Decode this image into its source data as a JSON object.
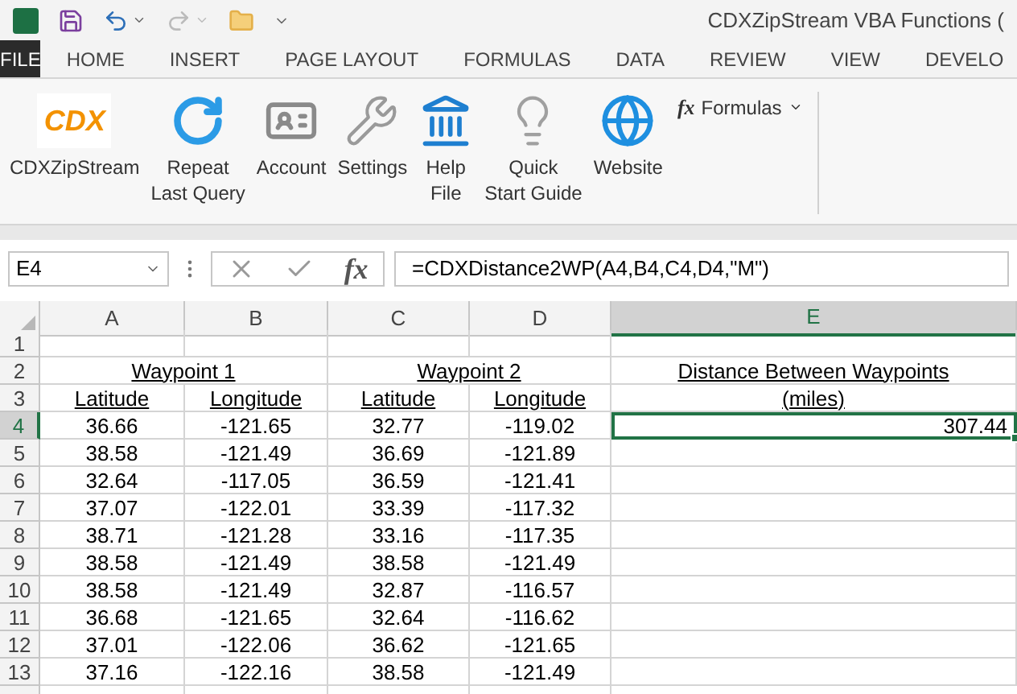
{
  "window": {
    "title": "CDXZipStream VBA Functions ("
  },
  "ribbon_tabs": [
    {
      "label": "FILE",
      "selected": true
    },
    {
      "label": "HOME",
      "selected": false
    },
    {
      "label": "INSERT",
      "selected": false
    },
    {
      "label": "PAGE LAYOUT",
      "selected": false
    },
    {
      "label": "FORMULAS",
      "selected": false
    },
    {
      "label": "DATA",
      "selected": false
    },
    {
      "label": "REVIEW",
      "selected": false
    },
    {
      "label": "VIEW",
      "selected": false
    },
    {
      "label": "DEVELO",
      "selected": false
    }
  ],
  "ribbon": {
    "logo_text": "CDX",
    "buttons": [
      {
        "lines": [
          "CDXZipStream"
        ]
      },
      {
        "lines": [
          "Repeat",
          "Last Query"
        ]
      },
      {
        "lines": [
          "Account"
        ]
      },
      {
        "lines": [
          "Settings"
        ]
      },
      {
        "lines": [
          "Help",
          "File"
        ]
      },
      {
        "lines": [
          "Quick",
          "Start Guide"
        ]
      },
      {
        "lines": [
          "Website"
        ]
      }
    ],
    "formulas_menu": {
      "icon_text": "fx",
      "label": "Formulas"
    }
  },
  "formula_bar": {
    "name_box": "E4",
    "function_button": "fx",
    "formula": "=CDXDistance2WP(A4,B4,C4,D4,\"M\")"
  },
  "sheet": {
    "columns": [
      {
        "label": "A",
        "selected": false
      },
      {
        "label": "B",
        "selected": false
      },
      {
        "label": "C",
        "selected": false
      },
      {
        "label": "D",
        "selected": false
      },
      {
        "label": "E",
        "selected": true
      }
    ],
    "rows": [
      {
        "label": "1",
        "selected": false
      },
      {
        "label": "2",
        "selected": false,
        "cells": [
          {
            "text": "Waypoint 1",
            "kind": "title",
            "selected": false
          },
          {
            "text": "Waypoint 2",
            "kind": "title",
            "selected": false
          },
          {
            "text": "Distance Between Waypoints",
            "kind": "label",
            "selected": false
          }
        ]
      },
      {
        "label": "3",
        "selected": false,
        "cells": [
          {
            "text": "Latitude",
            "kind": "label",
            "selected": false
          },
          {
            "text": "Longitude",
            "kind": "label",
            "selected": false
          },
          {
            "text": "Latitude",
            "kind": "label",
            "selected": false
          },
          {
            "text": "Longitude",
            "kind": "label",
            "selected": false
          },
          {
            "text": "(miles)",
            "kind": "label",
            "selected": false
          }
        ]
      },
      {
        "label": "4",
        "selected": true,
        "cells": [
          {
            "text": "36.66",
            "kind": "number",
            "selected": false
          },
          {
            "text": "-121.65",
            "kind": "number",
            "selected": false
          },
          {
            "text": "32.77",
            "kind": "number",
            "selected": false
          },
          {
            "text": "-119.02",
            "kind": "number",
            "selected": false
          },
          {
            "text": "307.44",
            "kind": "result",
            "selected": true
          }
        ]
      },
      {
        "label": "5",
        "selected": false,
        "cells": [
          {
            "text": "38.58",
            "kind": "number",
            "selected": false
          },
          {
            "text": "-121.49",
            "kind": "number",
            "selected": false
          },
          {
            "text": "36.69",
            "kind": "number",
            "selected": false
          },
          {
            "text": "-121.89",
            "kind": "number",
            "selected": false
          }
        ]
      },
      {
        "label": "6",
        "selected": false,
        "cells": [
          {
            "text": "32.64",
            "kind": "number",
            "selected": false
          },
          {
            "text": "-117.05",
            "kind": "number",
            "selected": false
          },
          {
            "text": "36.59",
            "kind": "number",
            "selected": false
          },
          {
            "text": "-121.41",
            "kind": "number",
            "selected": false
          }
        ]
      },
      {
        "label": "7",
        "selected": false,
        "cells": [
          {
            "text": "37.07",
            "kind": "number",
            "selected": false
          },
          {
            "text": "-122.01",
            "kind": "number",
            "selected": false
          },
          {
            "text": "33.39",
            "kind": "number",
            "selected": false
          },
          {
            "text": "-117.32",
            "kind": "number",
            "selected": false
          }
        ]
      },
      {
        "label": "8",
        "selected": false,
        "cells": [
          {
            "text": "38.71",
            "kind": "number",
            "selected": false
          },
          {
            "text": "-121.28",
            "kind": "number",
            "selected": false
          },
          {
            "text": "33.16",
            "kind": "number",
            "selected": false
          },
          {
            "text": "-117.35",
            "kind": "number",
            "selected": false
          }
        ]
      },
      {
        "label": "9",
        "selected": false,
        "cells": [
          {
            "text": "38.58",
            "kind": "number",
            "selected": false
          },
          {
            "text": "-121.49",
            "kind": "number",
            "selected": false
          },
          {
            "text": "38.58",
            "kind": "number",
            "selected": false
          },
          {
            "text": "-121.49",
            "kind": "number",
            "selected": false
          }
        ]
      },
      {
        "label": "10",
        "selected": false,
        "cells": [
          {
            "text": "38.58",
            "kind": "number",
            "selected": false
          },
          {
            "text": "-121.49",
            "kind": "number",
            "selected": false
          },
          {
            "text": "32.87",
            "kind": "number",
            "selected": false
          },
          {
            "text": "-116.57",
            "kind": "number",
            "selected": false
          }
        ]
      },
      {
        "label": "11",
        "selected": false,
        "cells": [
          {
            "text": "36.68",
            "kind": "number",
            "selected": false
          },
          {
            "text": "-121.65",
            "kind": "number",
            "selected": false
          },
          {
            "text": "32.64",
            "kind": "number",
            "selected": false
          },
          {
            "text": "-116.62",
            "kind": "number",
            "selected": false
          }
        ]
      },
      {
        "label": "12",
        "selected": false,
        "cells": [
          {
            "text": "37.01",
            "kind": "number",
            "selected": false
          },
          {
            "text": "-122.06",
            "kind": "number",
            "selected": false
          },
          {
            "text": "36.62",
            "kind": "number",
            "selected": false
          },
          {
            "text": "-121.65",
            "kind": "number",
            "selected": false
          }
        ]
      },
      {
        "label": "13",
        "selected": false,
        "cells": [
          {
            "text": "37.16",
            "kind": "number",
            "selected": false
          },
          {
            "text": "-122.16",
            "kind": "number",
            "selected": false
          },
          {
            "text": "38.58",
            "kind": "number",
            "selected": false
          },
          {
            "text": "-121.49",
            "kind": "number",
            "selected": false
          }
        ]
      }
    ]
  }
}
